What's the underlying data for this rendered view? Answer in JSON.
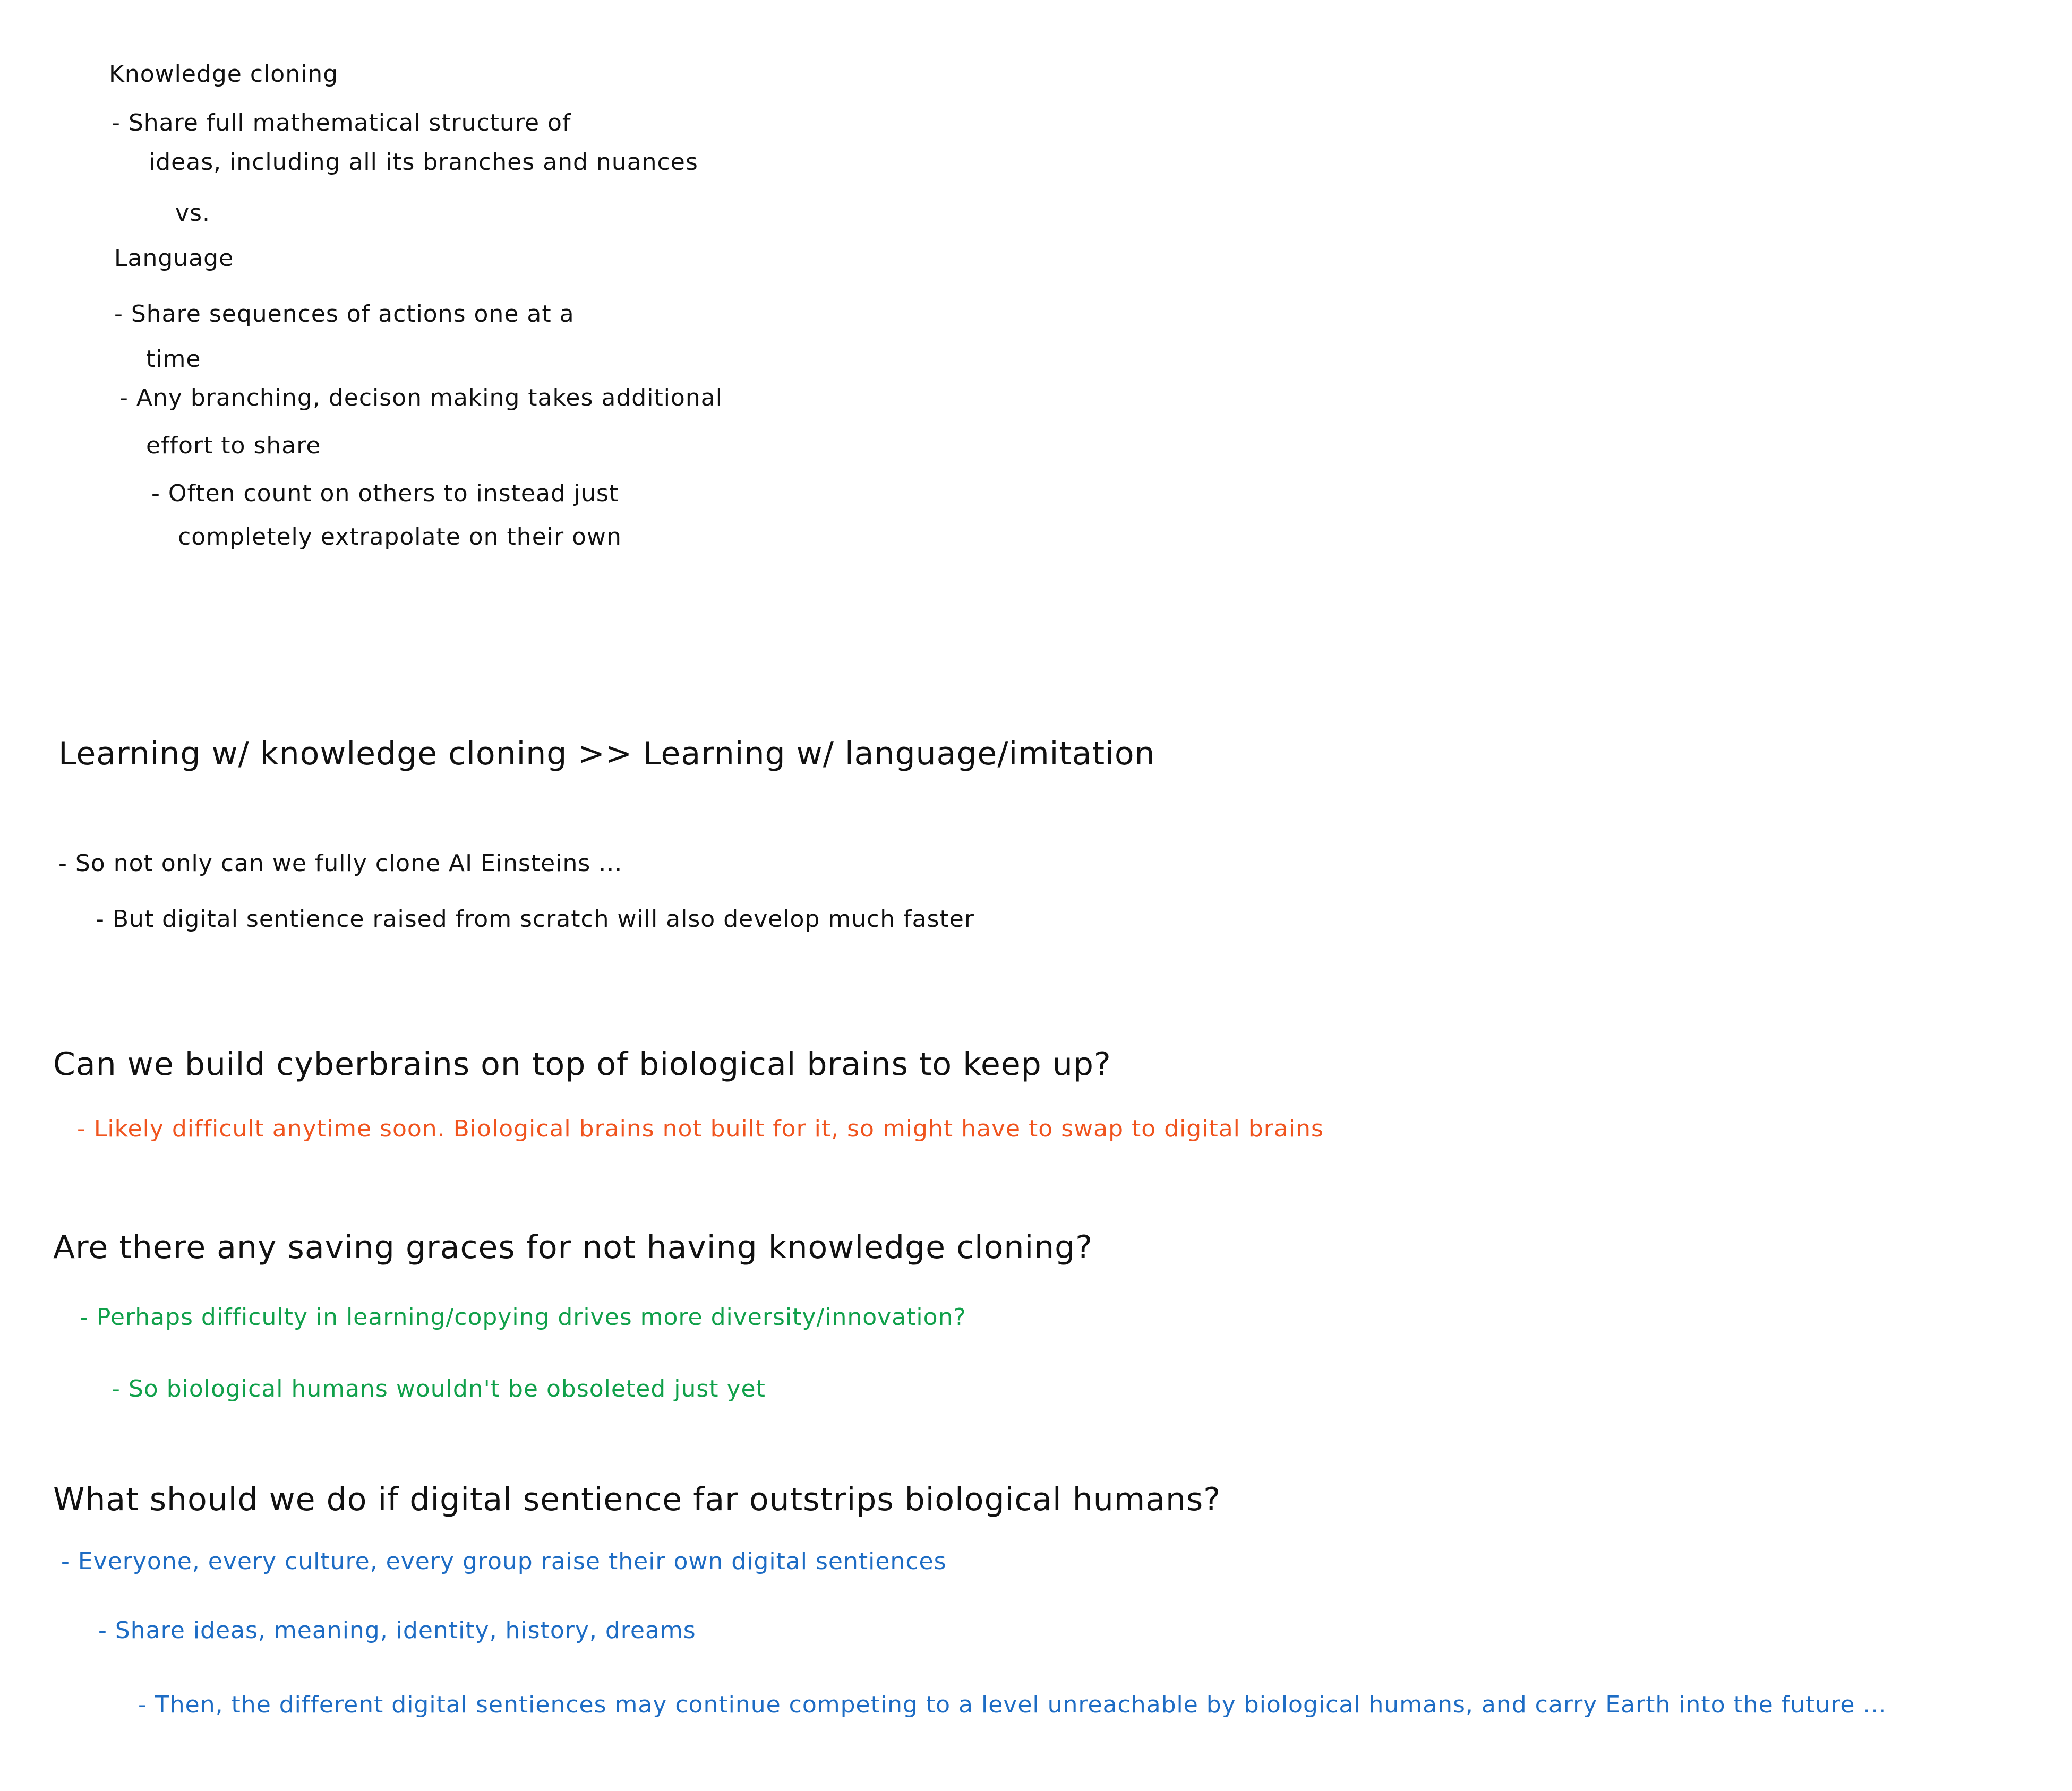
{
  "notes": {
    "colors": {
      "default": "#111111",
      "orange": "#f0541e",
      "green": "#10a04a",
      "blue": "#1d6cc4"
    },
    "section1": {
      "heading": "Knowledge cloning",
      "bullet1_line1": "- Share full mathematical structure of",
      "bullet1_line2": "ideas, including all its branches and nuances",
      "vs": "vs.",
      "heading2": "Language",
      "bullet2_line1": "- Share sequences of actions one at a",
      "bullet2_line2": "time",
      "bullet3_line1": "- Any branching, decison making takes additional",
      "bullet3_line2": "effort to share",
      "bullet4_line1": "- Often count on others to instead just",
      "bullet4_line2": "completely extrapolate on their own"
    },
    "section2": {
      "heading": "Learning w/ knowledge cloning >> Learning w/ language/imitation",
      "bullet1": "- So not only can we fully clone AI Einsteins ...",
      "bullet2": "- But digital sentience raised from scratch will also develop much faster"
    },
    "section3": {
      "question": "Can we build cyberbrains on top of biological brains to keep up?",
      "answer": "- Likely difficult anytime soon. Biological brains not built for it, so might have to swap to digital brains"
    },
    "section4": {
      "question": "Are there any saving graces for not having knowledge cloning?",
      "answer1": "- Perhaps difficulty in learning/copying drives more diversity/innovation?",
      "answer2": "- So biological humans wouldn't be obsoleted just yet"
    },
    "section5": {
      "question": "What should we do if digital sentience far outstrips biological humans?",
      "answer1": "- Everyone, every culture, every group raise their own digital sentiences",
      "answer2": "- Share ideas, meaning, identity, history, dreams",
      "answer3": "- Then, the different digital sentiences may continue competing to a level unreachable by biological humans, and carry Earth into the future ..."
    }
  }
}
